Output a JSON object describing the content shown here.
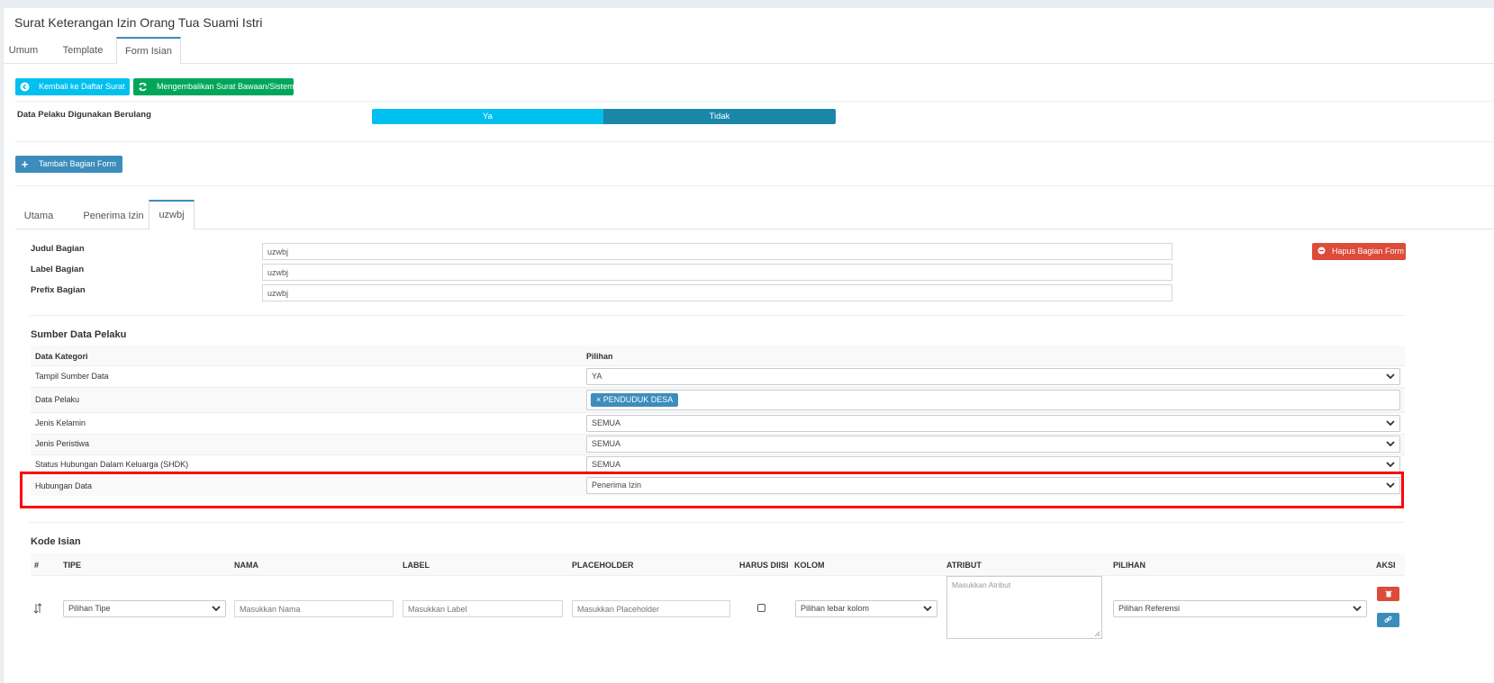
{
  "page": {
    "title": "Surat Keterangan Izin Orang Tua Suami Istri",
    "tabs": [
      {
        "label": "Umum"
      },
      {
        "label": "Template"
      },
      {
        "label": "Form Isian"
      }
    ]
  },
  "toolbar": {
    "back_label": "Kembali ke Daftar Surat",
    "restore_label": "Mengembalikan Surat Bawaan/Sistem"
  },
  "repeat": {
    "label": "Data Pelaku Digunakan Berulang",
    "yes": "Ya",
    "no": "Tidak"
  },
  "add_section_label": "Tambah Bagian Form",
  "section_tabs": [
    {
      "label": "Utama"
    },
    {
      "label": "Penerima Izin"
    },
    {
      "label": "uzwbj"
    }
  ],
  "section": {
    "judul_label": "Judul Bagian",
    "judul_value": "uzwbj",
    "label_label": "Label Bagian",
    "label_value": "uzwbj",
    "prefix_label": "Prefix Bagian",
    "prefix_value": "uzwbj",
    "delete_label": "Hapus Bagian Form"
  },
  "sumber": {
    "heading": "Sumber Data Pelaku",
    "col_kategori": "Data Kategori",
    "col_pilihan": "Pilihan",
    "rows": [
      {
        "label": "Tampil Sumber Data",
        "value": "YA"
      },
      {
        "label": "Data Pelaku",
        "value": "PENDUDUK DESA",
        "tag_x": "×"
      },
      {
        "label": "Jenis Kelamin",
        "value": "SEMUA"
      },
      {
        "label": "Jenis Peristiwa",
        "value": "SEMUA"
      },
      {
        "label": "Status Hubungan Dalam Keluarga (SHDK)",
        "value": "SEMUA"
      },
      {
        "label": "Hubungan Data",
        "value": "Penerima Izin"
      }
    ]
  },
  "kode": {
    "heading": "Kode Isian",
    "headers": {
      "num": "#",
      "tipe": "TIPE",
      "nama": "NAMA",
      "label": "LABEL",
      "placeholder": "PLACEHOLDER",
      "harus": "HARUS DIISI",
      "kolom": "KOLOM",
      "atribut": "ATRIBUT",
      "pilihan": "PILIHAN",
      "aksi": "AKSI"
    },
    "row": {
      "tipe": "Pilihan Tipe",
      "nama_ph": "Masukkan Nama",
      "label_ph": "Masukkan Label",
      "placeholder_ph": "Masukkan Placeholder",
      "kolom": "Pilihan lebar kolom",
      "atribut_ph": "Masukkan Atribut",
      "pilihan": "Pilihan Referensi"
    }
  },
  "colors": {
    "cyan": "#00c0ef",
    "cyan_dark": "#1b87a8",
    "green": "#00a65a",
    "blue": "#3c8dbc",
    "red": "#dd4b39",
    "highlight": "#ff0000"
  }
}
